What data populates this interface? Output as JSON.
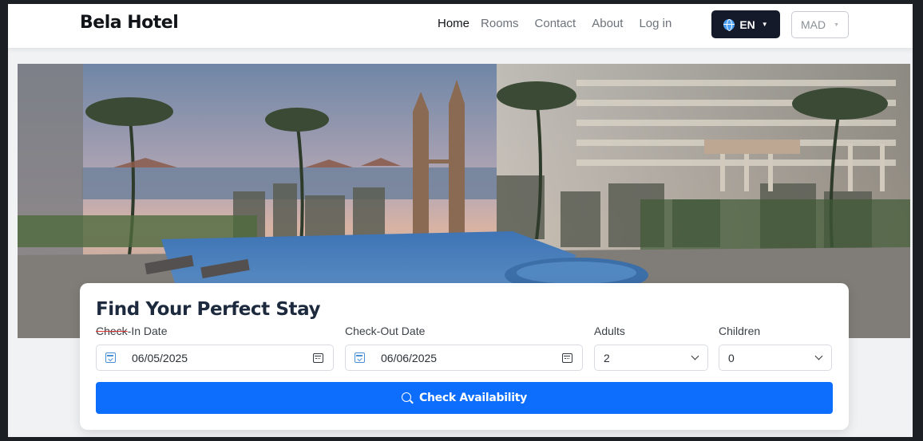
{
  "brand": "Bela Hotel",
  "nav": {
    "links": [
      "Home",
      "Rooms",
      "Contact",
      "About",
      "Log in"
    ],
    "active": "Home"
  },
  "language": {
    "label": "EN",
    "icon": "globe-icon"
  },
  "currency": {
    "label": "MAD"
  },
  "hero": {
    "icon": "hotel-hero-image"
  },
  "search": {
    "title": "Find Your Perfect Stay",
    "checkin_label_struck": "Check",
    "checkin_label_rest": "-In Date",
    "checkin_value": "06/05/2025",
    "checkout_label": "Check-Out Date",
    "checkout_value": "06/06/2025",
    "adults_label": "Adults",
    "adults_value": "2",
    "children_label": "Children",
    "children_value": "0",
    "submit_label": "Check Availability"
  },
  "colors": {
    "primary": "#0d6efd",
    "dark_button": "#141a2a",
    "title": "#1d2a3e"
  }
}
